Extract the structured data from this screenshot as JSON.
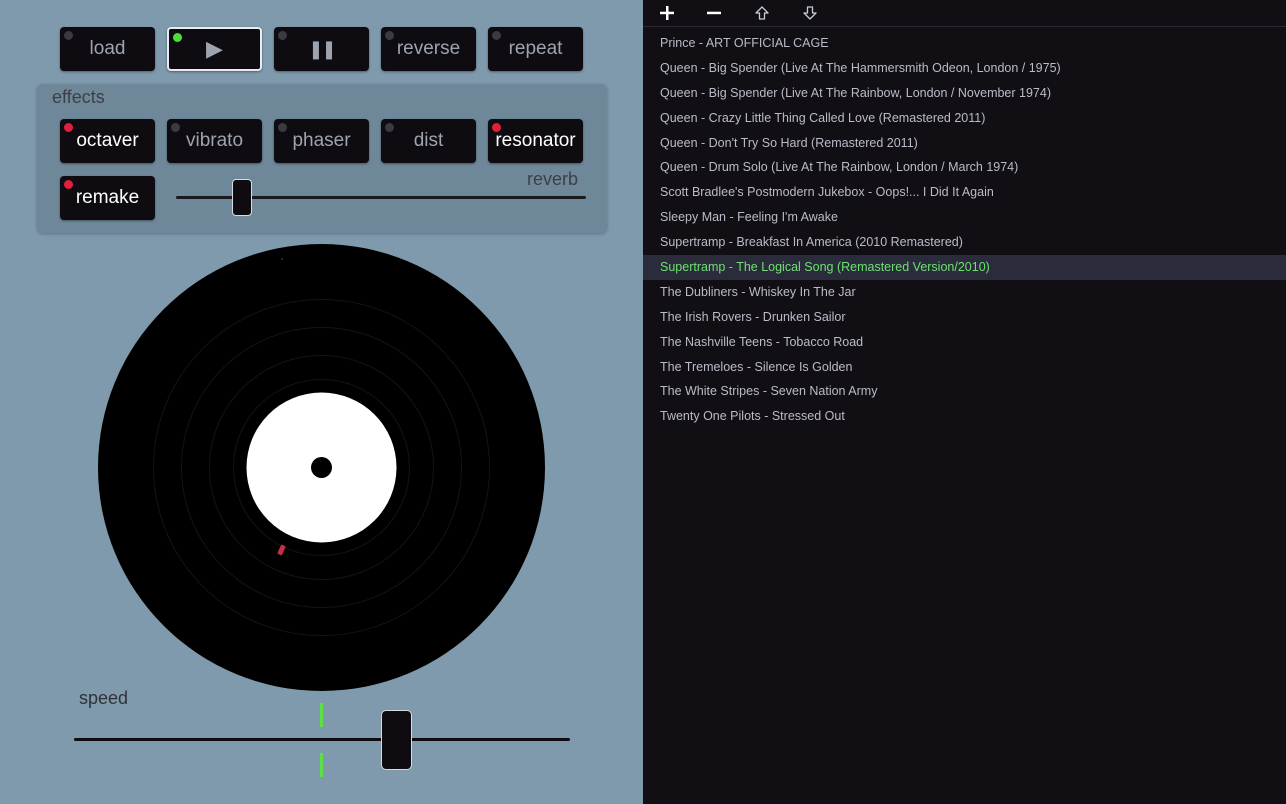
{
  "transport": {
    "load": "load",
    "play": "▶",
    "pause": "❚❚",
    "reverse": "reverse",
    "repeat": "repeat"
  },
  "effects": {
    "title": "effects",
    "octaver": "octaver",
    "vibrato": "vibrato",
    "phaser": "phaser",
    "dist": "dist",
    "resonator": "resonator",
    "remake": "remake",
    "reverb_label": "reverb",
    "reverb_level": 0.16
  },
  "speed": {
    "label": "speed",
    "level": 0.65
  },
  "colors": {
    "led_on_green": "#4ddc3c",
    "led_on_red": "#e0203a",
    "playing_text": "#6fe070",
    "panel_bg": "#7f9aad"
  },
  "toolbar": {
    "add_icon": "plus-icon",
    "remove_icon": "minus-icon",
    "up_icon": "arrow-up-icon",
    "down_icon": "arrow-down-icon"
  },
  "playlist": {
    "tracks": [
      "Prince - ART OFFICIAL CAGE",
      "Queen - Big Spender (Live At The Hammersmith Odeon, London / 1975)",
      "Queen - Big Spender (Live At The Rainbow, London / November 1974)",
      "Queen - Crazy Little Thing Called Love (Remastered 2011)",
      "Queen - Don't Try So Hard (Remastered 2011)",
      "Queen - Drum Solo (Live At The Rainbow, London / March 1974)",
      "Scott Bradlee's Postmodern Jukebox - Oops!... I Did It Again",
      "Sleepy Man - Feeling I'm Awake",
      "Supertramp - Breakfast In America (2010 Remastered)",
      "Supertramp - The Logical Song (Remastered Version/2010)",
      "The Dubliners - Whiskey In The Jar",
      "The Irish Rovers - Drunken Sailor",
      "The Nashville Teens - Tobacco Road",
      "The Tremeloes - Silence Is Golden",
      "The White Stripes - Seven Nation Army",
      "Twenty One Pilots - Stressed Out"
    ],
    "playing_index": 9
  }
}
